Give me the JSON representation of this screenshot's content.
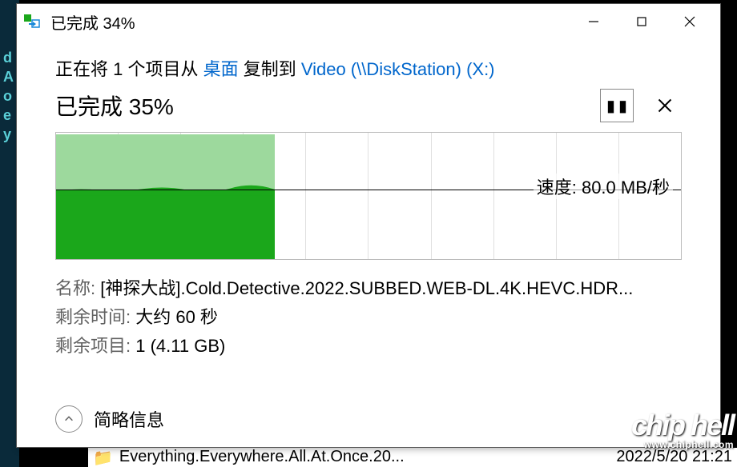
{
  "titlebar": {
    "title": "已完成 34%"
  },
  "copy_line": {
    "prefix": "正在将 1 个项目从 ",
    "source": "桌面",
    "middle": " 复制到 ",
    "destination": "Video (\\\\DiskStation) (X:)"
  },
  "progress": {
    "label": "已完成 35%"
  },
  "chart_data": {
    "type": "area",
    "progress_percent": 35,
    "midline_fraction": 0.45,
    "speed_label_prefix": "速度: ",
    "speed_value": "80.0 MB/秒",
    "colors": {
      "upper": "#9dd99d",
      "lower": "#1ba71b",
      "grid": "#e0e0e0"
    },
    "grid_columns": 10
  },
  "details": {
    "name_label": "名称: ",
    "name_value": "[神探大战].Cold.Detective.2022.SUBBED.WEB-DL.4K.HEVC.HDR...",
    "time_label": "剩余时间: ",
    "time_value": "大约 60 秒",
    "items_label": "剩余项目: ",
    "items_value": "1 (4.11 GB)"
  },
  "footer": {
    "toggle_label": "简略信息"
  },
  "watermark": {
    "big": "chip hell",
    "url": "www.chiphell.com"
  },
  "background_file": {
    "name": "Everything.Everywhere.All.At.Once.20...",
    "date": "2022/5/20 21:21"
  },
  "bg_letters": "d\nA\no\n\n\n\n\n\ne\ny\n"
}
